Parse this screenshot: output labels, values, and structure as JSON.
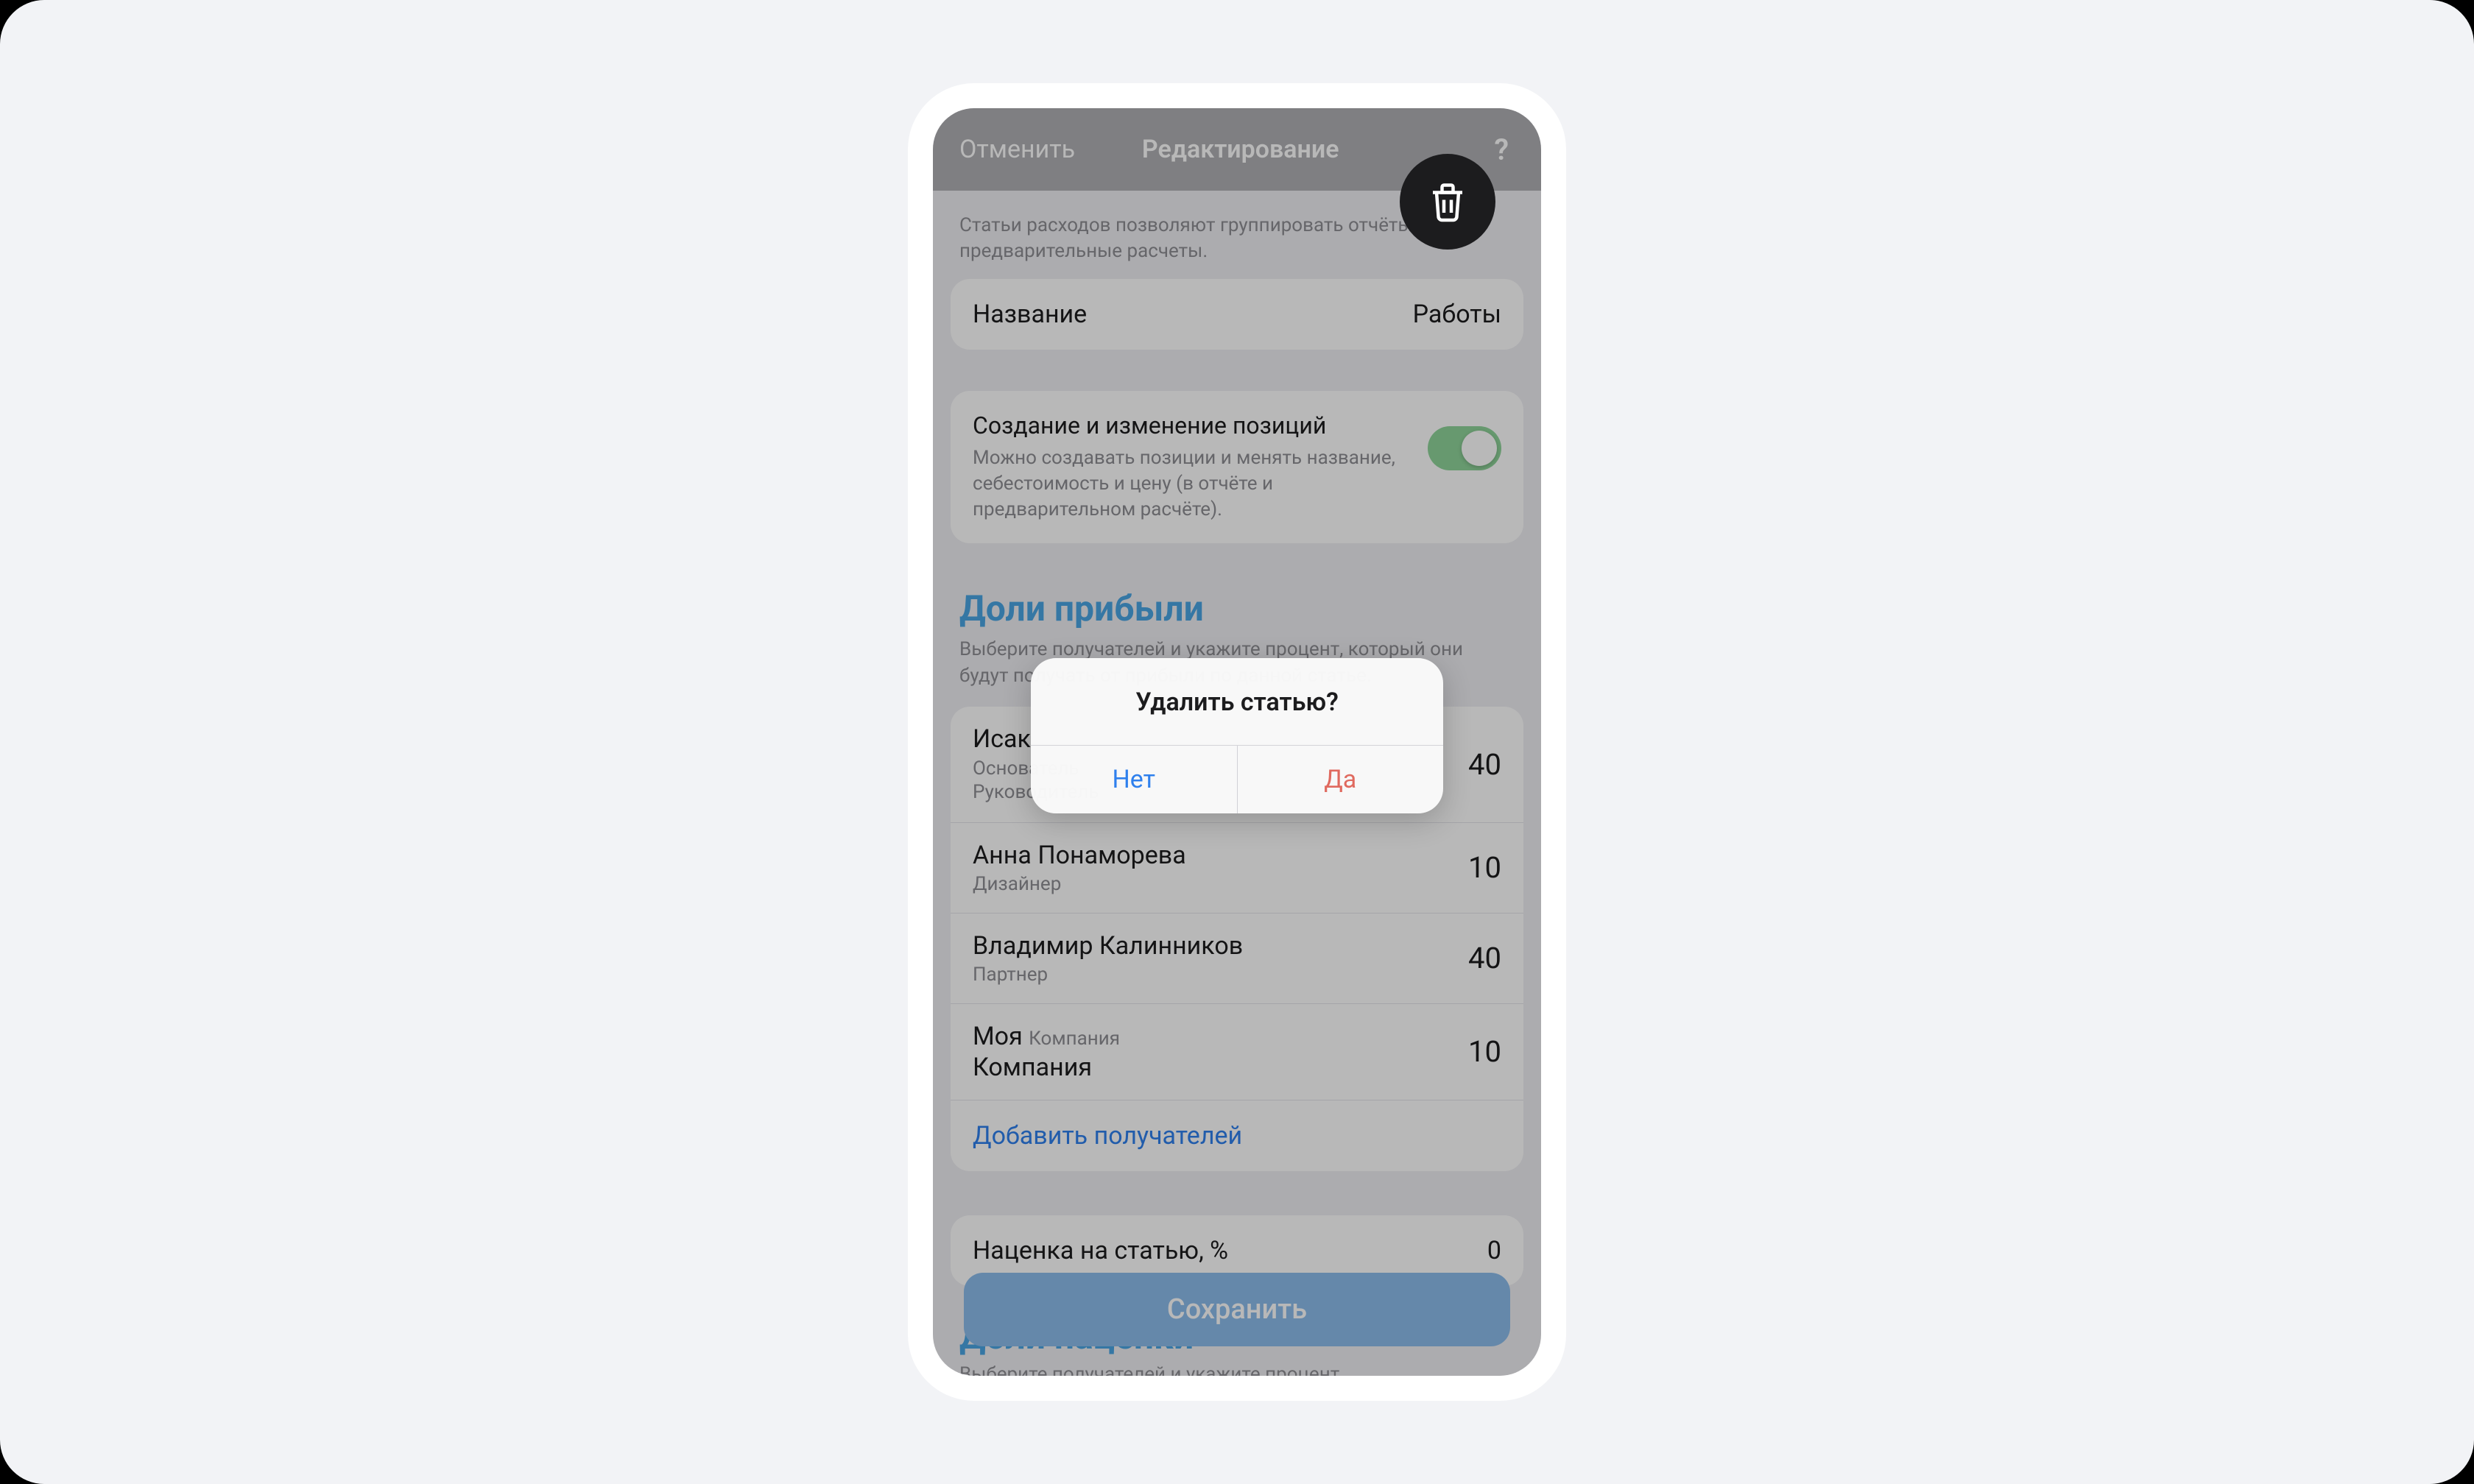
{
  "nav": {
    "cancel": "Отменить",
    "title": "Редактирование",
    "help": "?"
  },
  "hint": "Статьи расходов позволяют группировать отчёты и предварительные расчеты.",
  "nameRow": {
    "label": "Название",
    "value": "Работы"
  },
  "toggle": {
    "title": "Создание и изменение позиций",
    "desc": "Можно создавать позиции и менять название, себестоимость и цену (в отчёте и предварительном расчёте).",
    "on": true
  },
  "shares": {
    "title": "Доли прибыли",
    "desc": "Выберите получателей и укажите процент, который они будут получать от прибыли по данной статье.",
    "addLabel": "Добавить получателей",
    "people": [
      {
        "name": "Исак",
        "role1": "Основатель",
        "role2": "Руководитель",
        "value": "40"
      },
      {
        "name": "Анна Понаморева",
        "role": "Дизайнер",
        "value": "10"
      },
      {
        "name": "Владимир Калинников",
        "role": "Партнер",
        "value": "40"
      },
      {
        "name": "Моя",
        "muted": "Компания",
        "subtitle": "Компания",
        "value": "10"
      }
    ]
  },
  "markup": {
    "label": "Наценка на статью, %",
    "value": "0"
  },
  "markupSection": {
    "title": "Доли наценки",
    "desc": "Выберите получателей и укажите процент"
  },
  "save": {
    "label": "Сохранить"
  },
  "alert": {
    "title": "Удалить статью?",
    "no": "Нет",
    "yes": "Да"
  }
}
